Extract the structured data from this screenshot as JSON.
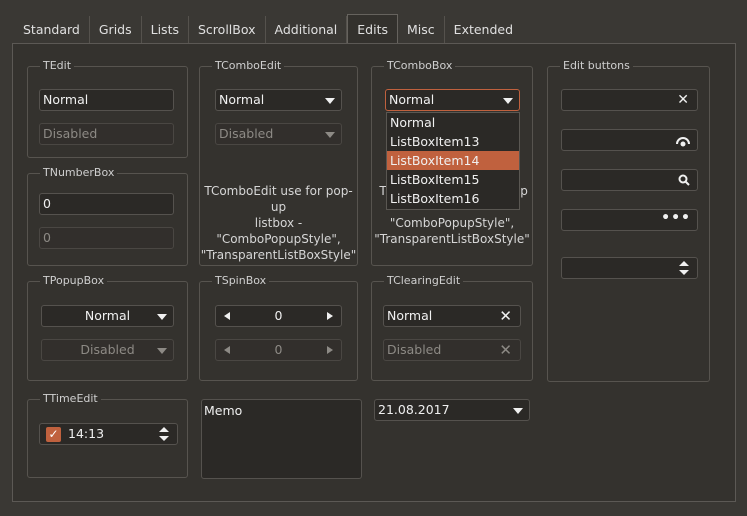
{
  "tabs": [
    "Standard",
    "Grids",
    "Lists",
    "ScrollBox",
    "Additional",
    "Edits",
    "Misc",
    "Extended"
  ],
  "active_tab": "Edits",
  "tedit": {
    "title": "TEdit",
    "normal": "Normal",
    "disabled": "Disabled"
  },
  "tcomboedit": {
    "title": "TComboEdit",
    "normal": "Normal",
    "disabled": "Disabled",
    "note1": "TComboEdit use for pop-up",
    "note2": "listbox -",
    "note3": "\"ComboPopupStyle\",",
    "note4": "\"TransparentListBoxStyle\""
  },
  "tcombobox": {
    "title": "TComboBox",
    "value": "Normal",
    "note_partial_left": "T",
    "note_partial_right": "p",
    "note3": "\"ComboPopupStyle\",",
    "note4": "\"TransparentListBoxStyle\"",
    "popup_items": [
      "Normal",
      "ListBoxItem13",
      "ListBoxItem14",
      "ListBoxItem15",
      "ListBoxItem16"
    ],
    "selected_item": "ListBoxItem14"
  },
  "edit_buttons": {
    "title": "Edit buttons",
    "icons": [
      "clear-icon",
      "password-eye-icon",
      "search-icon",
      "ellipsis-icon",
      "spin-icon"
    ]
  },
  "tnumberbox": {
    "title": "TNumberBox",
    "value1": "0",
    "value2": "0"
  },
  "tpopupbox": {
    "title": "TPopupBox",
    "normal": "Normal",
    "disabled": "Disabled"
  },
  "tspinbox": {
    "title": "TSpinBox",
    "value1": "0",
    "value2": "0"
  },
  "tclearingedit": {
    "title": "TClearingEdit",
    "normal": "Normal",
    "disabled": "Disabled"
  },
  "ttimeedit": {
    "title": "TTimeEdit",
    "time": "14:13",
    "checked": true
  },
  "memo": {
    "text": "Memo"
  },
  "dateedit": {
    "value": "21.08.2017"
  },
  "colors": {
    "accent": "#c0613e",
    "background": "#34322e"
  }
}
